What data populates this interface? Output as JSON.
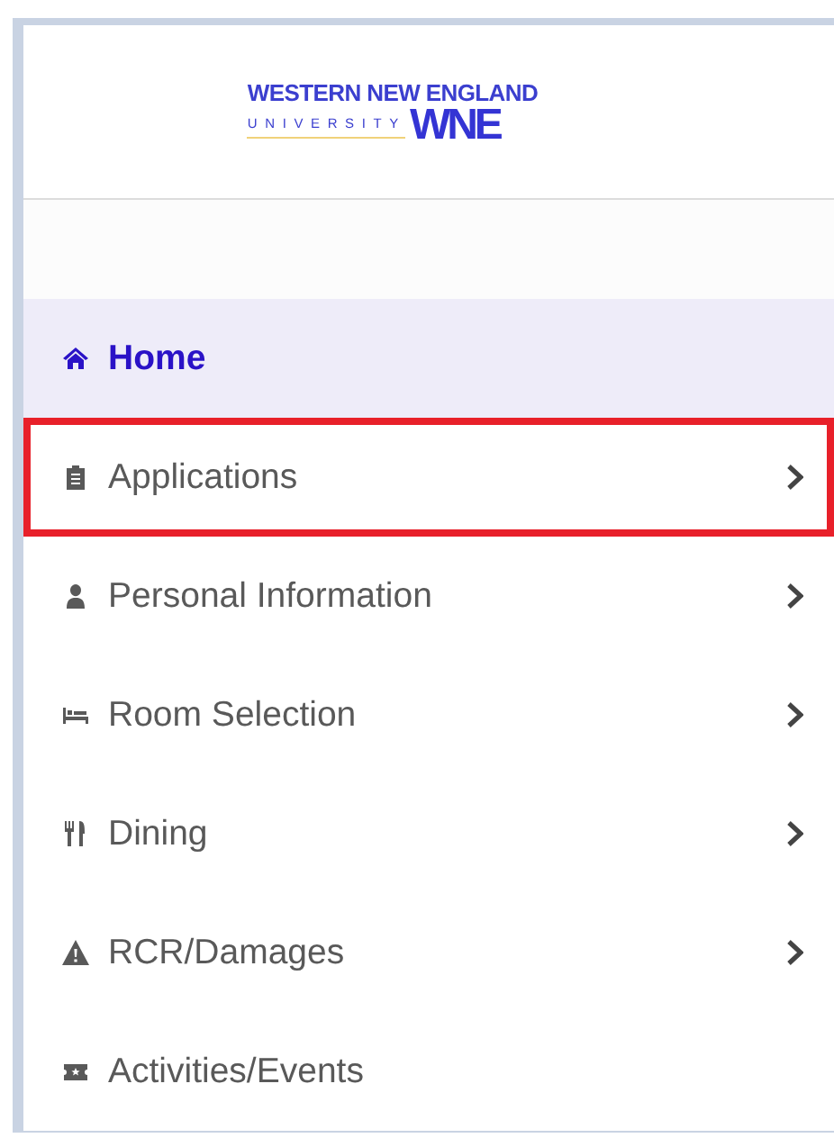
{
  "logo": {
    "top_line": "WESTERN NEW ENGLAND",
    "university": "UNIVERSITY",
    "mark": "WNE"
  },
  "menu": [
    {
      "label": "Home",
      "selected": true,
      "highlighted": false,
      "has_submenu": false
    },
    {
      "label": "Applications",
      "selected": false,
      "highlighted": true,
      "has_submenu": true
    },
    {
      "label": "Personal Information",
      "selected": false,
      "highlighted": false,
      "has_submenu": true
    },
    {
      "label": "Room Selection",
      "selected": false,
      "highlighted": false,
      "has_submenu": true
    },
    {
      "label": "Dining",
      "selected": false,
      "highlighted": false,
      "has_submenu": true
    },
    {
      "label": "RCR/Damages",
      "selected": false,
      "highlighted": false,
      "has_submenu": true
    },
    {
      "label": "Activities/Events",
      "selected": false,
      "highlighted": false,
      "has_submenu": false
    }
  ]
}
